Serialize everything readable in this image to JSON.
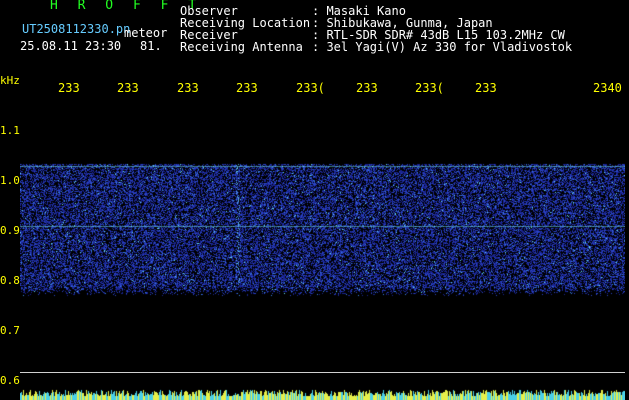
{
  "header": {
    "app_title": "H R O F F T",
    "filename": "UT2508112330.pn",
    "label_meteor": "meteor",
    "datetime": "25.08.11 23:30",
    "count": "81.",
    "info_labels": [
      "Observer",
      "Receiving Location",
      "Receiver",
      "Receiving Antenna"
    ],
    "info_values": [
      ": Masaki Kano",
      ": Shibukawa, Gunma, Japan",
      ": RTL-SDR SDR# 43dB L15 103.2MHz CW",
      ": 3el Yagi(V) Az 330 for Vladivostok"
    ]
  },
  "axis": {
    "unit": "kHz",
    "y_labels": [
      "1.1",
      "1.0",
      "0.9",
      "0.8",
      "0.7",
      "0.6"
    ],
    "time_labels": [
      "233",
      "233",
      "233",
      "233",
      "233(",
      "233",
      "233(",
      "233",
      "2340"
    ]
  },
  "colors": {
    "background": "#000000",
    "signal": "#2040c0",
    "label": "#ffff00",
    "title": "#22ff22"
  }
}
